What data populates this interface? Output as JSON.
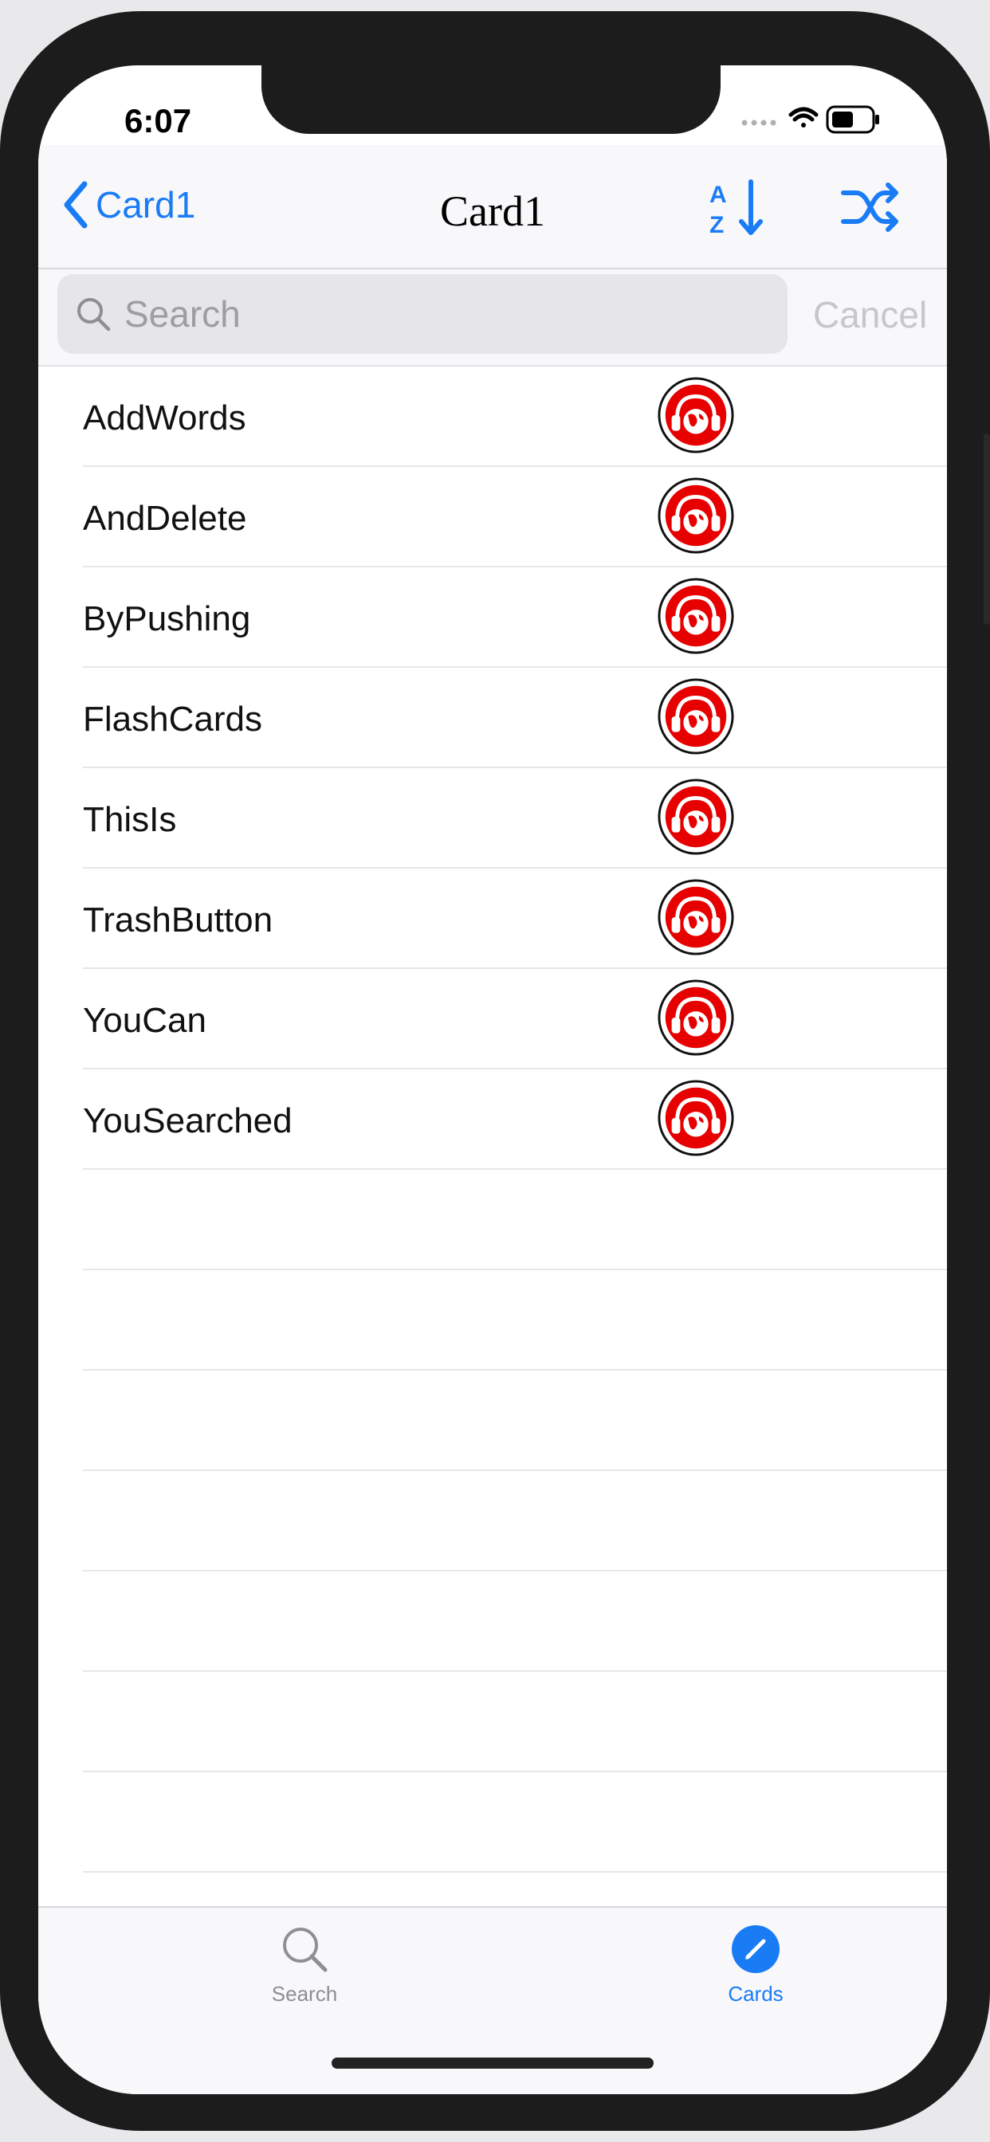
{
  "status": {
    "time": "6:07"
  },
  "nav": {
    "back_label": "Card1",
    "title": "Card1",
    "sort_icon": "sort-az-icon",
    "shuffle_icon": "shuffle-icon"
  },
  "search": {
    "placeholder": "Search",
    "value": "",
    "cancel_label": "Cancel"
  },
  "words": [
    {
      "label": "AddWords"
    },
    {
      "label": "AndDelete"
    },
    {
      "label": "ByPushing"
    },
    {
      "label": "FlashCards"
    },
    {
      "label": "ThisIs"
    },
    {
      "label": "TrashButton"
    },
    {
      "label": "YouCan"
    },
    {
      "label": "YouSearched"
    }
  ],
  "tabs": [
    {
      "label": "Search",
      "icon": "magnifier-icon",
      "selected": false
    },
    {
      "label": "Cards",
      "icon": "pencil-circle-icon",
      "selected": true
    }
  ],
  "colors": {
    "accent": "#1a7cf5",
    "audio_icon": "#e60000"
  }
}
